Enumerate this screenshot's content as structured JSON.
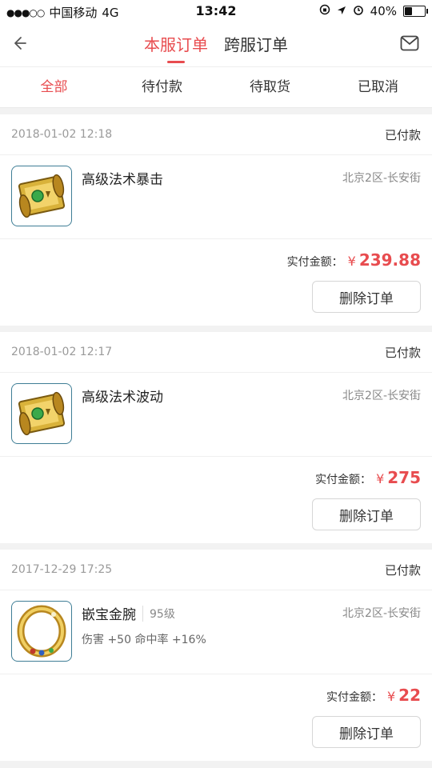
{
  "status_bar": {
    "signal": "●●●○○",
    "carrier": "中国移动",
    "network": "4G",
    "time": "13:42",
    "battery": "40%",
    "battery_level": 0.4
  },
  "nav": {
    "tabs": [
      {
        "label": "本服订单",
        "active": true
      },
      {
        "label": "跨服订单",
        "active": false
      }
    ]
  },
  "filters": [
    {
      "label": "全部",
      "active": true
    },
    {
      "label": "待付款",
      "active": false
    },
    {
      "label": "待取货",
      "active": false
    },
    {
      "label": "已取消",
      "active": false
    }
  ],
  "orders": [
    {
      "date": "2018-01-02 12:18",
      "status": "已付款",
      "item_name": "高级法术暴击",
      "level": "",
      "attributes": "",
      "server": "北京2区-长安街",
      "amount_label": "实付金额：",
      "currency": "¥",
      "price": "239.88",
      "delete_label": "删除订单",
      "icon": "scroll-icon"
    },
    {
      "date": "2018-01-02 12:17",
      "status": "已付款",
      "item_name": "高级法术波动",
      "level": "",
      "attributes": "",
      "server": "北京2区-长安街",
      "amount_label": "实付金额：",
      "currency": "¥",
      "price": "275",
      "delete_label": "删除订单",
      "icon": "scroll-icon"
    },
    {
      "date": "2017-12-29 17:25",
      "status": "已付款",
      "item_name": "嵌宝金腕",
      "level": "95级",
      "attributes": "伤害 +50 命中率 +16%",
      "server": "北京2区-长安街",
      "amount_label": "实付金额：",
      "currency": "¥",
      "price": "22",
      "delete_label": "删除订单",
      "icon": "bracelet-icon"
    }
  ],
  "colors": {
    "accent": "#e84c4f"
  }
}
